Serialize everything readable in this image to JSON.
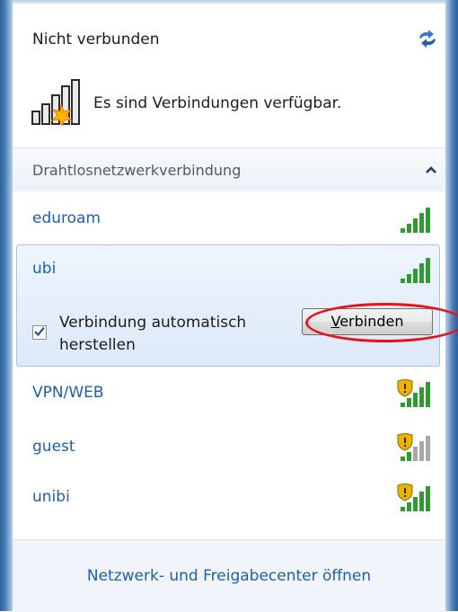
{
  "status": {
    "title": "Nicht verbunden",
    "available_text": "Es sind Verbindungen verfügbar.",
    "refresh_icon": "refresh-arrows-icon",
    "available_icon": "signal-bars-star-icon"
  },
  "section": {
    "title": "Drahtlosnetzwerkverbindung",
    "collapse_icon": "chevron-up-icon"
  },
  "networks": [
    {
      "name": "eduroam",
      "secured": false,
      "signal": 5
    },
    {
      "name": "ubi",
      "secured": false,
      "signal": 5,
      "selected": true
    },
    {
      "name": "VPN/WEB",
      "secured": true,
      "signal": 5
    },
    {
      "name": "guest",
      "secured": true,
      "signal": 2
    },
    {
      "name": "unibi",
      "secured": true,
      "signal": 5
    }
  ],
  "selected_network": {
    "auto_connect_label": "Verbindung automatisch herstellen",
    "auto_connect_checked": true,
    "connect_button": {
      "mnemonic": "V",
      "rest": "erbinden"
    }
  },
  "footer": {
    "link": "Netzwerk- und Freigabecenter öffnen"
  },
  "colors": {
    "link": "#1f5fa8",
    "signal_green": "#2e9d2e",
    "signal_gray": "#a8a8a8",
    "highlight_ring": "#e3141c",
    "shield": "#e8b400"
  }
}
